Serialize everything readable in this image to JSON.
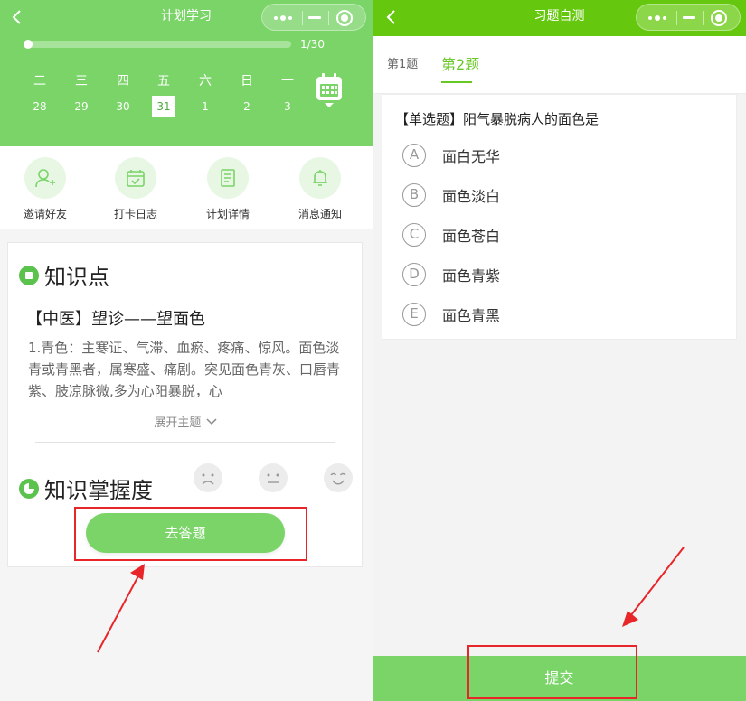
{
  "left": {
    "nav": {
      "title": "计划学习"
    },
    "progress": {
      "value": 1,
      "total": 30,
      "label": "1/30"
    },
    "week": [
      {
        "wk": "二",
        "date": "28",
        "active": false
      },
      {
        "wk": "三",
        "date": "29",
        "active": false
      },
      {
        "wk": "四",
        "date": "30",
        "active": false
      },
      {
        "wk": "五",
        "date": "31",
        "active": true
      },
      {
        "wk": "六",
        "date": "1",
        "active": false
      },
      {
        "wk": "日",
        "date": "2",
        "active": false
      },
      {
        "wk": "一",
        "date": "3",
        "active": false
      }
    ],
    "quick_actions": [
      {
        "label": "邀请好友",
        "icon": "invite-icon"
      },
      {
        "label": "打卡日志",
        "icon": "calendar-check-icon"
      },
      {
        "label": "计划详情",
        "icon": "document-icon"
      },
      {
        "label": "消息通知",
        "icon": "bell-icon"
      }
    ],
    "knowledge": {
      "section_title": "知识点",
      "title": "【中医】望诊——望面色",
      "body": "1.青色：主寒证、气滞、血瘀、疼痛、惊风。面色淡青或青黑者，属寒盛、痛剧。突见面色青灰、口唇青紫、肢凉脉微,多为心阳暴脱，心",
      "expand_label": "展开主题"
    },
    "mastery": {
      "section_title": "知识掌握度",
      "faces": [
        "sad-face-icon",
        "neutral-face-icon",
        "happy-face-icon"
      ],
      "button_label": "去答题"
    }
  },
  "right": {
    "nav": {
      "title": "习题自测"
    },
    "tabs": [
      {
        "label": "第1题",
        "active": false
      },
      {
        "label": "第2题",
        "active": true
      }
    ],
    "question": {
      "text": "【单选题】阳气暴脱病人的面色是",
      "options": [
        {
          "letter": "A",
          "text": "面白无华"
        },
        {
          "letter": "B",
          "text": "面色淡白"
        },
        {
          "letter": "C",
          "text": "面色苍白"
        },
        {
          "letter": "D",
          "text": "面色青紫"
        },
        {
          "letter": "E",
          "text": "面色青黑"
        }
      ]
    },
    "submit_label": "提交"
  },
  "colors": {
    "header_green_left": "#7ad468",
    "header_green_right": "#66c80e",
    "accent_green": "#67c723",
    "highlight_red": "#e8262a"
  }
}
